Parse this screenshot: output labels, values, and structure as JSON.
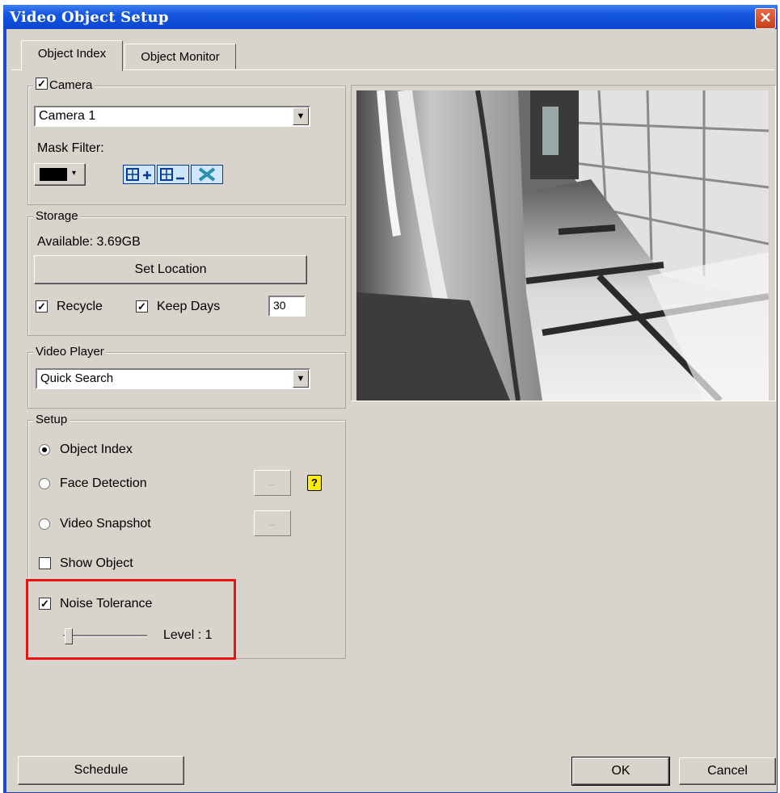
{
  "window": {
    "title": "Video Object Setup",
    "close_glyph": "✕"
  },
  "tabs": [
    {
      "label": "Object Index",
      "active": true
    },
    {
      "label": "Object Monitor",
      "active": false
    }
  ],
  "camera": {
    "group_label": "Camera",
    "checked": true,
    "selected": "Camera 1",
    "mask_filter_label": "Mask Filter:",
    "mask_color": "#000000",
    "mask_tools": [
      "add-mask-icon",
      "remove-mask-icon",
      "clear-mask-icon"
    ]
  },
  "storage": {
    "group_label": "Storage",
    "available": "Available: 3.69GB",
    "set_location_label": "Set Location",
    "recycle_label": "Recycle",
    "recycle_checked": true,
    "keep_days_label": "Keep Days",
    "keep_days_checked": true,
    "keep_days_value": "30"
  },
  "video_player": {
    "group_label": "Video Player",
    "selected": "Quick Search"
  },
  "setup": {
    "group_label": "Setup",
    "options": [
      {
        "label": "Object Index",
        "selected": true
      },
      {
        "label": "Face Detection",
        "selected": false
      },
      {
        "label": "Video Snapshot",
        "selected": false
      }
    ],
    "options_button_label": "...",
    "help_glyph": "?",
    "show_object_label": "Show Object",
    "show_object_checked": false,
    "noise_tolerance_label": "Noise Tolerance",
    "noise_tolerance_checked": true,
    "level_text": "Level : 1",
    "level_value": 1
  },
  "footer": {
    "schedule_label": "Schedule",
    "ok_label": "OK",
    "cancel_label": "Cancel"
  },
  "colors": {
    "title_bar": "#0a46cf",
    "highlight": "#e11111",
    "dialog_bg": "#d8d4cc"
  }
}
